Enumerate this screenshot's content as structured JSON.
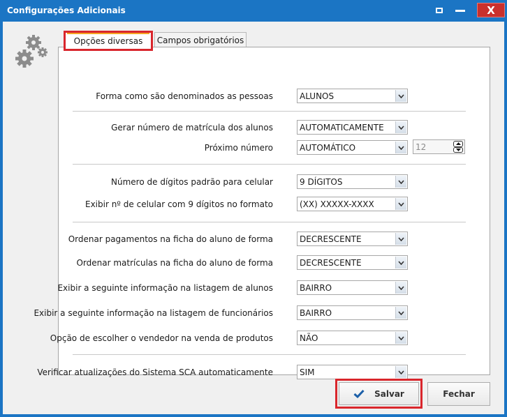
{
  "window": {
    "title": "Configurações Adicionais",
    "controls": {
      "restore": "▪",
      "minimize": "—",
      "close": "X"
    }
  },
  "tabs": [
    {
      "label": "Opções diversas",
      "active": true
    },
    {
      "label": "Campos obrigatórios",
      "active": false
    }
  ],
  "fields": {
    "pessoas": {
      "label": "Forma como são denominados as pessoas",
      "value": "ALUNOS"
    },
    "gerar_matricula": {
      "label": "Gerar número de matrícula dos alunos",
      "value": "AUTOMATICAMENTE"
    },
    "proximo_numero": {
      "label": "Próximo número",
      "value": "AUTOMÁTICO",
      "number": "12"
    },
    "digitos_celular": {
      "label": "Número de dígitos padrão para celular",
      "value": "9 DÍGITOS"
    },
    "formato_celular": {
      "label": "Exibir nº de celular com 9 dígitos no formato",
      "value": "(XX) XXXXX-XXXX"
    },
    "ordem_pagamentos": {
      "label": "Ordenar pagamentos na ficha do aluno de forma",
      "value": "DECRESCENTE"
    },
    "ordem_matriculas": {
      "label": "Ordenar matrículas na ficha do aluno de forma",
      "value": "DECRESCENTE"
    },
    "info_alunos": {
      "label": "Exibir a seguinte informação na listagem de alunos",
      "value": "BAIRRO"
    },
    "info_funcionarios": {
      "label": "Exibir a seguinte informação na listagem de funcionários",
      "value": "BAIRRO"
    },
    "vendedor": {
      "label": "Opção de escolher o vendedor na venda de produtos",
      "value": "NÃO"
    },
    "atualizacoes": {
      "label": "Verificar atualizações do Sistema SCA automaticamente",
      "value": "SIM"
    }
  },
  "buttons": {
    "save": "Salvar",
    "close": "Fechar"
  },
  "colors": {
    "titlebar": "#1b75c4",
    "highlight": "#d9262c",
    "tab_accent": "#f5a623",
    "check": "#1b5fa8"
  },
  "icons": {
    "settings": "gears-icon",
    "save": "checkmark-icon",
    "dropdown": "chevron-down-icon"
  }
}
